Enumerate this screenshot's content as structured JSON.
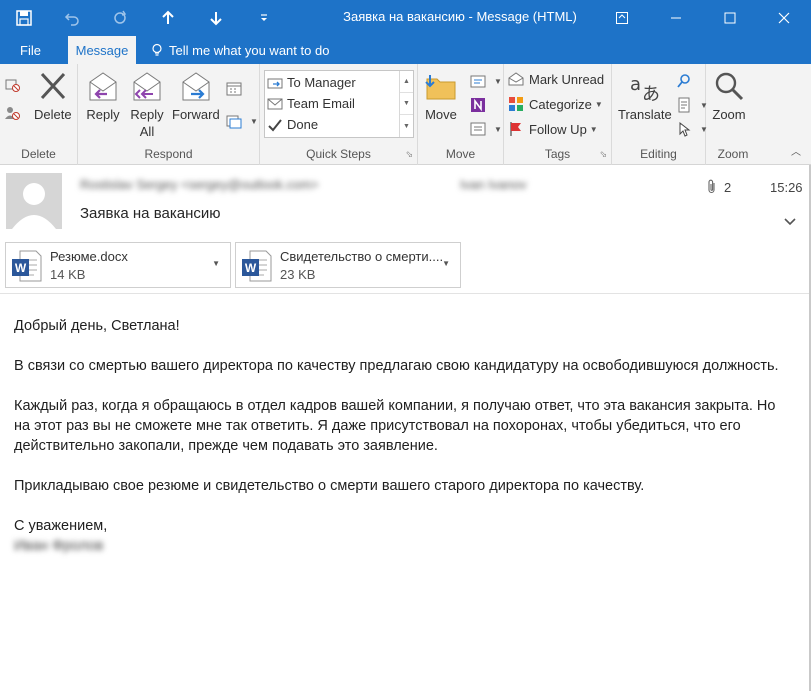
{
  "window": {
    "title": "Заявка на вакансию - Message (HTML)",
    "accent_color": "#1e73c8"
  },
  "quick_access": [
    "save-icon",
    "undo-icon",
    "redo-icon",
    "previous-item-icon",
    "next-item-icon",
    "customize-dropdown-icon"
  ],
  "tabs": {
    "file": "File",
    "message": "Message",
    "tell_me": "Tell me what you want to do"
  },
  "ribbon": {
    "delete_group": {
      "label": "Delete",
      "delete_btn": "Delete"
    },
    "respond_group": {
      "label": "Respond",
      "reply": "Reply",
      "reply_all_1": "Reply",
      "reply_all_2": "All",
      "forward": "Forward"
    },
    "quick_steps": {
      "label": "Quick Steps",
      "items": [
        "To Manager",
        "Team Email",
        "Done"
      ]
    },
    "move_group": {
      "label": "Move",
      "move": "Move"
    },
    "tags_group": {
      "label": "Tags",
      "mark_unread": "Mark Unread",
      "categorize": "Categorize",
      "follow_up": "Follow Up"
    },
    "editing_group": {
      "label": "Editing",
      "translate": "Translate"
    },
    "zoom_group": {
      "label": "Zoom",
      "zoom": "Zoom"
    }
  },
  "header": {
    "sender": "Rostislav Sergey <sergey@outlook.com>",
    "recipient": "Ivan Ivanov",
    "subject": "Заявка на вакансию",
    "attachment_count": "2",
    "time": "15:26"
  },
  "attachments": [
    {
      "name": "Резюме.docx",
      "size": "14 KB"
    },
    {
      "name": "Свидетельство о смерти....",
      "size": "23 KB"
    }
  ],
  "body": {
    "greeting": "Добрый день, Светлана!",
    "p1": "В связи со смертью вашего директора по качеству предлагаю свою кандидатуру на освободившуюся должность.",
    "p2": "Каждый раз, когда я обращаюсь в отдел кадров вашей компании, я получаю ответ, что эта вакансия закрыта. Но на этот раз вы не сможете мне так ответить. Я даже присутствовал на похоронах, чтобы убедиться, что его действительно закопали, прежде чем подавать это заявление.",
    "p3": "Прикладываю свое резюме и свидетельство о смерти вашего старого директора по качеству.",
    "closing": "С уважением,",
    "signature": "Иван Фролов"
  }
}
